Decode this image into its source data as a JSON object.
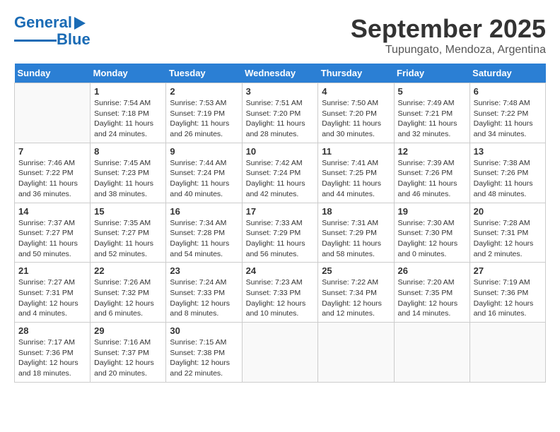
{
  "logo": {
    "line1": "General",
    "line2": "Blue"
  },
  "title": "September 2025",
  "subtitle": "Tupungato, Mendoza, Argentina",
  "headers": [
    "Sunday",
    "Monday",
    "Tuesday",
    "Wednesday",
    "Thursday",
    "Friday",
    "Saturday"
  ],
  "weeks": [
    [
      {
        "day": "",
        "info": ""
      },
      {
        "day": "1",
        "info": "Sunrise: 7:54 AM\nSunset: 7:18 PM\nDaylight: 11 hours\nand 24 minutes."
      },
      {
        "day": "2",
        "info": "Sunrise: 7:53 AM\nSunset: 7:19 PM\nDaylight: 11 hours\nand 26 minutes."
      },
      {
        "day": "3",
        "info": "Sunrise: 7:51 AM\nSunset: 7:20 PM\nDaylight: 11 hours\nand 28 minutes."
      },
      {
        "day": "4",
        "info": "Sunrise: 7:50 AM\nSunset: 7:20 PM\nDaylight: 11 hours\nand 30 minutes."
      },
      {
        "day": "5",
        "info": "Sunrise: 7:49 AM\nSunset: 7:21 PM\nDaylight: 11 hours\nand 32 minutes."
      },
      {
        "day": "6",
        "info": "Sunrise: 7:48 AM\nSunset: 7:22 PM\nDaylight: 11 hours\nand 34 minutes."
      }
    ],
    [
      {
        "day": "7",
        "info": "Sunrise: 7:46 AM\nSunset: 7:22 PM\nDaylight: 11 hours\nand 36 minutes."
      },
      {
        "day": "8",
        "info": "Sunrise: 7:45 AM\nSunset: 7:23 PM\nDaylight: 11 hours\nand 38 minutes."
      },
      {
        "day": "9",
        "info": "Sunrise: 7:44 AM\nSunset: 7:24 PM\nDaylight: 11 hours\nand 40 minutes."
      },
      {
        "day": "10",
        "info": "Sunrise: 7:42 AM\nSunset: 7:24 PM\nDaylight: 11 hours\nand 42 minutes."
      },
      {
        "day": "11",
        "info": "Sunrise: 7:41 AM\nSunset: 7:25 PM\nDaylight: 11 hours\nand 44 minutes."
      },
      {
        "day": "12",
        "info": "Sunrise: 7:39 AM\nSunset: 7:26 PM\nDaylight: 11 hours\nand 46 minutes."
      },
      {
        "day": "13",
        "info": "Sunrise: 7:38 AM\nSunset: 7:26 PM\nDaylight: 11 hours\nand 48 minutes."
      }
    ],
    [
      {
        "day": "14",
        "info": "Sunrise: 7:37 AM\nSunset: 7:27 PM\nDaylight: 11 hours\nand 50 minutes."
      },
      {
        "day": "15",
        "info": "Sunrise: 7:35 AM\nSunset: 7:27 PM\nDaylight: 11 hours\nand 52 minutes."
      },
      {
        "day": "16",
        "info": "Sunrise: 7:34 AM\nSunset: 7:28 PM\nDaylight: 11 hours\nand 54 minutes."
      },
      {
        "day": "17",
        "info": "Sunrise: 7:33 AM\nSunset: 7:29 PM\nDaylight: 11 hours\nand 56 minutes."
      },
      {
        "day": "18",
        "info": "Sunrise: 7:31 AM\nSunset: 7:29 PM\nDaylight: 11 hours\nand 58 minutes."
      },
      {
        "day": "19",
        "info": "Sunrise: 7:30 AM\nSunset: 7:30 PM\nDaylight: 12 hours\nand 0 minutes."
      },
      {
        "day": "20",
        "info": "Sunrise: 7:28 AM\nSunset: 7:31 PM\nDaylight: 12 hours\nand 2 minutes."
      }
    ],
    [
      {
        "day": "21",
        "info": "Sunrise: 7:27 AM\nSunset: 7:31 PM\nDaylight: 12 hours\nand 4 minutes."
      },
      {
        "day": "22",
        "info": "Sunrise: 7:26 AM\nSunset: 7:32 PM\nDaylight: 12 hours\nand 6 minutes."
      },
      {
        "day": "23",
        "info": "Sunrise: 7:24 AM\nSunset: 7:33 PM\nDaylight: 12 hours\nand 8 minutes."
      },
      {
        "day": "24",
        "info": "Sunrise: 7:23 AM\nSunset: 7:33 PM\nDaylight: 12 hours\nand 10 minutes."
      },
      {
        "day": "25",
        "info": "Sunrise: 7:22 AM\nSunset: 7:34 PM\nDaylight: 12 hours\nand 12 minutes."
      },
      {
        "day": "26",
        "info": "Sunrise: 7:20 AM\nSunset: 7:35 PM\nDaylight: 12 hours\nand 14 minutes."
      },
      {
        "day": "27",
        "info": "Sunrise: 7:19 AM\nSunset: 7:36 PM\nDaylight: 12 hours\nand 16 minutes."
      }
    ],
    [
      {
        "day": "28",
        "info": "Sunrise: 7:17 AM\nSunset: 7:36 PM\nDaylight: 12 hours\nand 18 minutes."
      },
      {
        "day": "29",
        "info": "Sunrise: 7:16 AM\nSunset: 7:37 PM\nDaylight: 12 hours\nand 20 minutes."
      },
      {
        "day": "30",
        "info": "Sunrise: 7:15 AM\nSunset: 7:38 PM\nDaylight: 12 hours\nand 22 minutes."
      },
      {
        "day": "",
        "info": ""
      },
      {
        "day": "",
        "info": ""
      },
      {
        "day": "",
        "info": ""
      },
      {
        "day": "",
        "info": ""
      }
    ]
  ]
}
